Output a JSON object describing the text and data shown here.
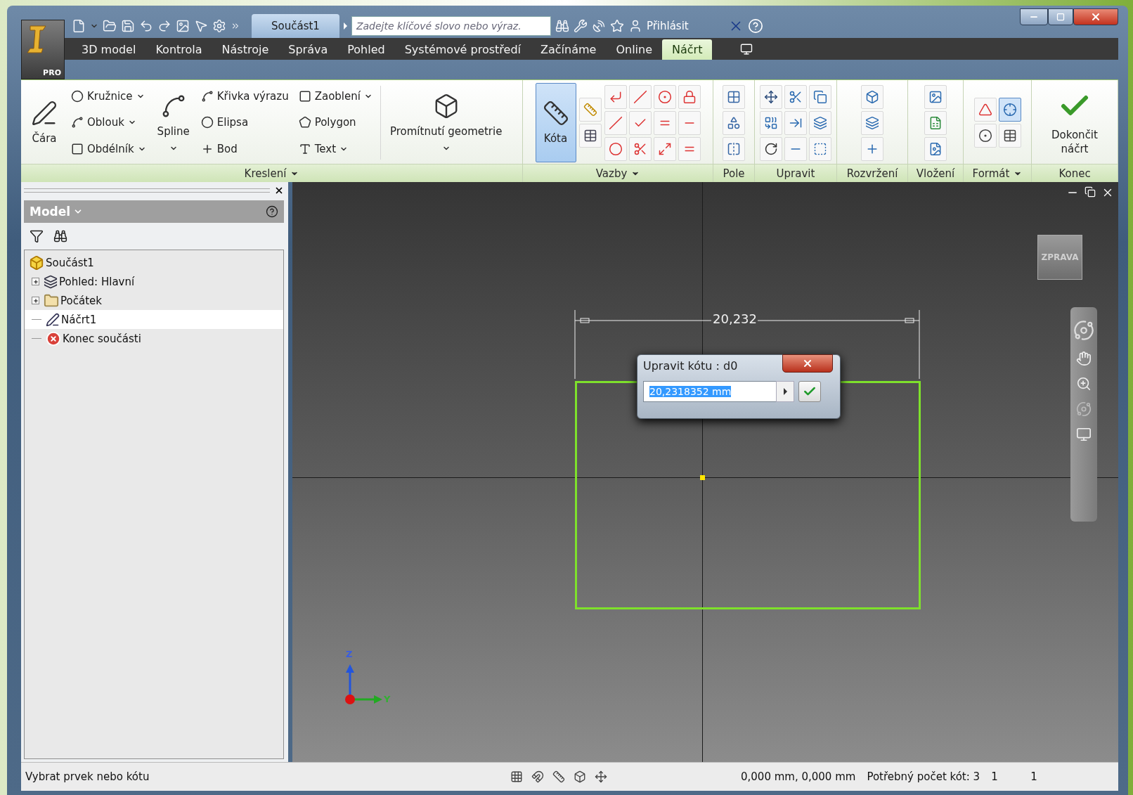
{
  "app": {
    "badge": "PRO",
    "document_title": "Součást1",
    "search": {
      "placeholder": "Zadejte klíčové slovo nebo výraz."
    },
    "sign_in": "Přihlásit"
  },
  "menu_tabs": [
    {
      "label": "3D model",
      "selected": false
    },
    {
      "label": "Kontrola",
      "selected": false
    },
    {
      "label": "Nástroje",
      "selected": false
    },
    {
      "label": "Správa",
      "selected": false
    },
    {
      "label": "Pohled",
      "selected": false
    },
    {
      "label": "Systémové prostředí",
      "selected": false
    },
    {
      "label": "Začínáme",
      "selected": false
    },
    {
      "label": "Online",
      "selected": false
    },
    {
      "label": "Náčrt",
      "selected": true
    }
  ],
  "ribbon": {
    "panels": [
      {
        "kind": "draw",
        "label": "Kreslení",
        "dropdown": true,
        "items": [
          {
            "kind": "large",
            "label": "Čára",
            "dropdown": false,
            "selected": false
          },
          {
            "kind": "column",
            "tools": [
              {
                "label": "Kružnice",
                "dropdown": true,
                "selected": false
              },
              {
                "label": "Oblouk",
                "dropdown": true,
                "selected": false
              },
              {
                "label": "Obdélník",
                "dropdown": true,
                "selected": false
              }
            ]
          },
          {
            "kind": "large",
            "label": "Spline",
            "dropdown": true,
            "selected": false
          },
          {
            "kind": "column",
            "tools": [
              {
                "label": "Křivka výrazu",
                "dropdown": false,
                "selected": false
              },
              {
                "label": "Elipsa",
                "dropdown": false,
                "selected": false
              },
              {
                "label": "Bod",
                "dropdown": false,
                "selected": false
              }
            ]
          },
          {
            "kind": "column",
            "tools": [
              {
                "label": "Zaoblení",
                "dropdown": true,
                "selected": false
              },
              {
                "label": "Polygon",
                "dropdown": false,
                "selected": false
              },
              {
                "label": "Text",
                "dropdown": true,
                "selected": false
              }
            ]
          },
          {
            "kind": "large",
            "label": "Promítnutí geometrie",
            "dropdown": true,
            "selected": false
          }
        ]
      },
      {
        "kind": "constraints",
        "label": "Vazby",
        "dropdown": true,
        "items": [
          {
            "kind": "large",
            "label": "Kóta",
            "dropdown": false,
            "selected": true
          }
        ]
      },
      {
        "kind": "pattern",
        "label": "Pole",
        "dropdown": false
      },
      {
        "kind": "modify",
        "label": "Upravit",
        "dropdown": false
      },
      {
        "kind": "layout",
        "label": "Rozvržení",
        "dropdown": false
      },
      {
        "kind": "insert",
        "label": "Vložení",
        "dropdown": false
      },
      {
        "kind": "format",
        "label": "Formát",
        "dropdown": true
      },
      {
        "kind": "exit",
        "label": "Konec",
        "dropdown": false,
        "items": [
          {
            "kind": "large",
            "label": "Dokončit náčrt",
            "dropdown": false,
            "selected": false
          }
        ]
      }
    ]
  },
  "browser": {
    "title": "Model",
    "tree": [
      {
        "kind": "part",
        "label": "Součást1",
        "collapsed": false,
        "selected": false,
        "children": [
          {
            "kind": "view",
            "label": "Pohled: Hlavní",
            "collapsed": true,
            "selected": false
          },
          {
            "kind": "folder",
            "label": "Počátek",
            "collapsed": true,
            "selected": false
          },
          {
            "kind": "sketch",
            "label": "Náčrt1",
            "collapsed": false,
            "selected": true
          },
          {
            "kind": "end",
            "label": "Konec součásti",
            "collapsed": false,
            "selected": false
          }
        ]
      }
    ]
  },
  "viewport": {
    "view_cube": "ZPRAVA",
    "dimension": "20,232",
    "edit_dialog": {
      "title": "Upravit kótu : d0",
      "value": "20,2318352 mm"
    },
    "axes": {
      "z": "Z",
      "y": "Y"
    }
  },
  "status_bar": {
    "prompt": "Vybrat prvek nebo kótu",
    "coordinates": "0,000 mm, 0,000 mm",
    "required_dimensions": "Potřebný počet kót: 3",
    "counter_1": "1",
    "counter_2": "1"
  }
}
